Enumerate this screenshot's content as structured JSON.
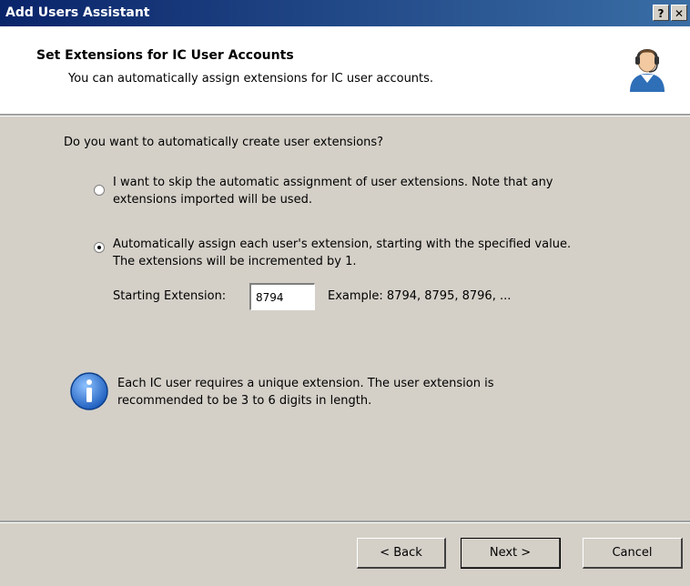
{
  "window": {
    "title": "Add Users Assistant",
    "help_label": "?",
    "close_label": "✕"
  },
  "header": {
    "title": "Set Extensions for IC User Accounts",
    "subtitle": "You can automatically assign extensions for IC user accounts.",
    "icon": "user-headset-icon"
  },
  "body": {
    "question": "Do you want to automatically create user extensions?",
    "options": [
      {
        "line1": "I want to skip the automatic assignment of user extensions. Note that any",
        "line2": "extensions imported will be used.",
        "selected": false
      },
      {
        "line1": "Automatically assign each user's extension, starting with the specified value.",
        "line2": "The extensions will be incremented by 1.",
        "selected": true
      }
    ],
    "starting_extension_label": "Starting Extension:",
    "starting_extension_value": "8794",
    "example_text": "Example: 8794, 8795, 8796, ...",
    "info_icon": "info-icon",
    "info_line1": "Each IC user requires a unique extension. The user extension is",
    "info_line2": "recommended to be 3 to 6 digits in length."
  },
  "footer": {
    "back_label": "< Back",
    "next_label": "Next >",
    "cancel_label": "Cancel"
  },
  "colors": {
    "titlebar_start": "#0a246a",
    "titlebar_end": "#3a6ea5",
    "dialog_bg": "#d4d0c8",
    "info_blue": "#1f5fbf"
  }
}
